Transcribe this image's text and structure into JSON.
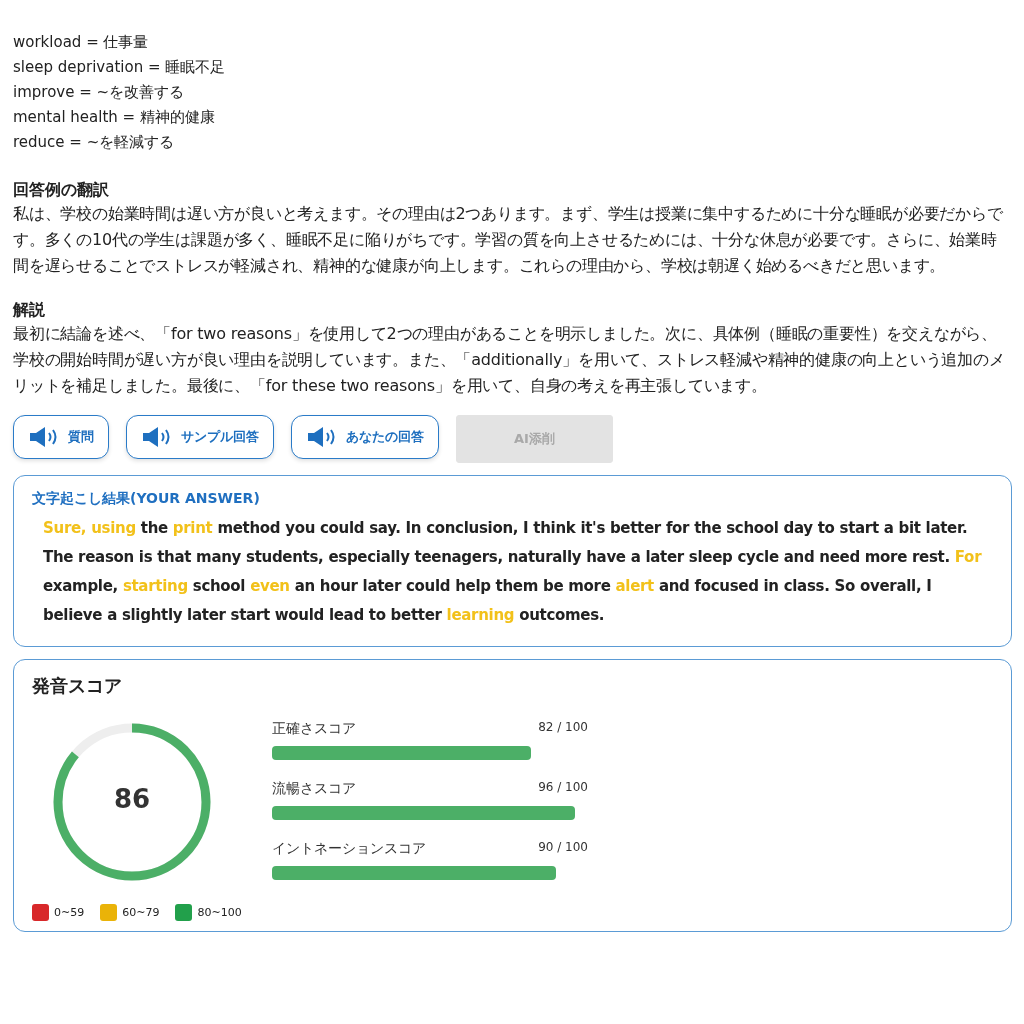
{
  "vocabulary": [
    "workload = 仕事量",
    "sleep deprivation = 睡眠不足",
    "improve = ~を改善する",
    "mental health = 精神的健康",
    "reduce = ~を軽減する"
  ],
  "sections": [
    {
      "heading": "回答例の翻訳",
      "body": "私は、学校の始業時間は遅い方が良いと考えます。その理由は2つあります。まず、学生は授業に集中するために十分な睡眠が必要だからです。多くの10代の学生は課題が多く、睡眠不足に陥りがちです。学習の質を向上させるためには、十分な休息が必要です。さらに、始業時間を遅らせることでストレスが軽減され、精神的な健康が向上します。これらの理由から、学校は朝遅く始めるべきだと思います。"
    },
    {
      "heading": "解説",
      "body": "最初に結論を述べ、「for two reasons」を使用して2つの理由があることを明示しました。次に、具体例（睡眠の重要性）を交えながら、学校の開始時間が遅い方が良い理由を説明しています。また、「additionally」を用いて、ストレス軽減や精神的健康の向上という追加のメリットを補足しました。最後に、「for these two reasons」を用いて、自身の考えを再主張しています。"
    }
  ],
  "buttons": [
    {
      "label": "質問",
      "kind": "audio",
      "disabled": false
    },
    {
      "label": "サンプル回答",
      "kind": "audio",
      "disabled": false
    },
    {
      "label": "あなたの回答",
      "kind": "audio",
      "disabled": false
    },
    {
      "label": "AI添削",
      "kind": "plain",
      "disabled": true
    }
  ],
  "transcript": {
    "title": "文字起こし結果(YOUR ANSWER)",
    "segments": [
      {
        "text": "Sure, using",
        "highlighted": true
      },
      {
        "text": " the ",
        "highlighted": false
      },
      {
        "text": "print",
        "highlighted": true
      },
      {
        "text": " method you could say. In conclusion, I think it's better for the school day to start a bit later. The reason is that many students, especially teenagers, naturally have a later sleep cycle and need more rest. ",
        "highlighted": false
      },
      {
        "text": "For",
        "highlighted": true
      },
      {
        "text": " example, ",
        "highlighted": false
      },
      {
        "text": "starting",
        "highlighted": true
      },
      {
        "text": " school ",
        "highlighted": false
      },
      {
        "text": "even",
        "highlighted": true
      },
      {
        "text": " an hour later could help them be more ",
        "highlighted": false
      },
      {
        "text": "alert",
        "highlighted": true
      },
      {
        "text": " and focused in class. So overall, I believe a slightly later start would lead to better ",
        "highlighted": false
      },
      {
        "text": "learning",
        "highlighted": true
      },
      {
        "text": " outcomes.",
        "highlighted": false
      }
    ]
  },
  "score": {
    "title": "発音スコア",
    "overall": "86",
    "metrics": [
      {
        "label": "正確さスコア",
        "reading": "82 / 100"
      },
      {
        "label": "流暢さスコア",
        "reading": "96 / 100"
      },
      {
        "label": "イントネーションスコア",
        "reading": "90 / 100"
      }
    ],
    "legend": [
      {
        "label": "0~59",
        "color": "#d8282a"
      },
      {
        "label": "60~79",
        "color": "#eab308"
      },
      {
        "label": "80~100",
        "color": "#22a04b"
      }
    ]
  }
}
